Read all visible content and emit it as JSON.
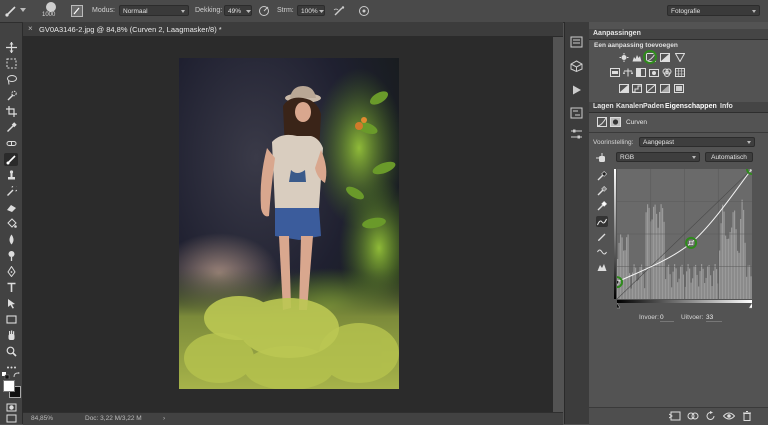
{
  "options_bar": {
    "brush_size": "1000",
    "mode_label": "Modus:",
    "mode_value": "Normaal",
    "opacity_label": "Dekking:",
    "opacity_value": "49%",
    "flow_label": "Strm:",
    "flow_value": "100%",
    "workspace": "Fotografie"
  },
  "document": {
    "tab_title": "GV0A3146-2.jpg @ 84,8% (Curven 2, Laagmasker/8) *",
    "zoom": "84,85%",
    "doc_info": "Doc: 3,22 M/3,22 M"
  },
  "adjustments_panel": {
    "title": "Aanpassingen",
    "subtitle": "Een aanpassing toevoegen"
  },
  "panel_tabs": [
    "Lagen",
    "Kanalen",
    "Paden",
    "Eigenschappen",
    "Info"
  ],
  "properties": {
    "type_label": "Curven",
    "preset_label": "Voorinstelling:",
    "preset_value": "Aangepast",
    "channel_value": "RGB",
    "auto_button": "Automatisch",
    "input_label": "Invoer:",
    "input_value": "0",
    "output_label": "Uitvoer:",
    "output_value": "33"
  },
  "curve": {
    "points": [
      [
        0,
        33
      ],
      [
        140,
        110
      ],
      [
        255,
        255
      ]
    ]
  },
  "colors": {
    "highlight_ring": "#2f8a1c",
    "panel_bg": "#535353",
    "canvas_bg": "#2b2b2b"
  }
}
